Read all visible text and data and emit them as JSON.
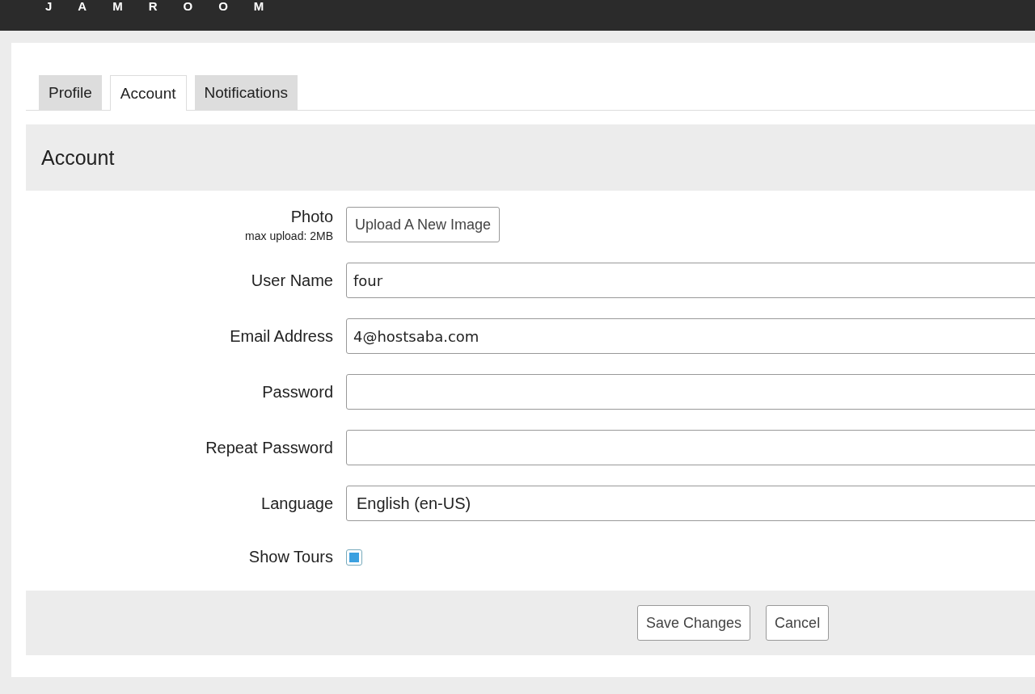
{
  "header": {
    "logo": "JAMROOM"
  },
  "tabs": [
    {
      "label": "Profile",
      "selected": false
    },
    {
      "label": "Account",
      "selected": true
    },
    {
      "label": "Notifications",
      "selected": false
    }
  ],
  "section": {
    "title": "Account"
  },
  "fields": [
    {
      "kind": "upload",
      "label": "Photo",
      "hint": "max upload: 2MB",
      "button": "Upload A New Image"
    },
    {
      "kind": "text",
      "label": "User Name",
      "value": "four"
    },
    {
      "kind": "text",
      "label": "Email Address",
      "value": "4@hostsaba.com"
    },
    {
      "kind": "text",
      "label": "Password"
    },
    {
      "kind": "text",
      "label": "Repeat Password"
    },
    {
      "kind": "select",
      "label": "Language",
      "value": "English (en-US)"
    },
    {
      "kind": "checkbox",
      "label": "Show Tours",
      "checked": true
    }
  ],
  "buttons": [
    "Save Changes",
    "Cancel"
  ]
}
